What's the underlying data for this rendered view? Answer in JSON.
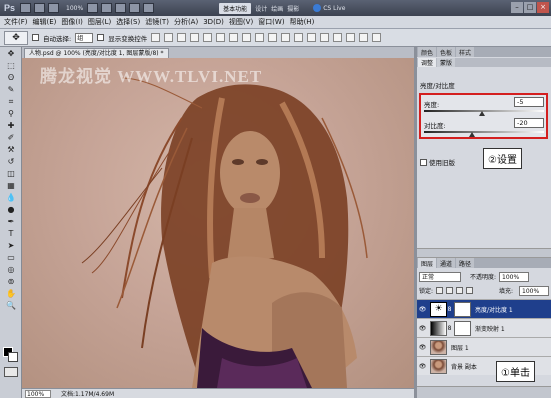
{
  "appbar": {
    "logo": "Ps",
    "zoom": "100%",
    "workspace_active": "基本功能",
    "workspace_options": [
      "设计",
      "绘画",
      "摄影"
    ],
    "cs_live": "CS Live"
  },
  "menu": [
    "文件(F)",
    "编辑(E)",
    "图像(I)",
    "图层(L)",
    "选择(S)",
    "滤镜(T)",
    "分析(A)",
    "3D(D)",
    "视图(V)",
    "窗口(W)",
    "帮助(H)"
  ],
  "options": {
    "auto_select_label": "自动选择:",
    "auto_select_value": "组",
    "show_transform_label": "显示变换控件"
  },
  "document": {
    "tab_title": "人物.psd @ 100% (亮度/对比度 1, 图层蒙版/8) *",
    "watermark": "腾龙视觉 WWW.TLVI.NET",
    "zoom_value": "100%",
    "doc_info": "文档:1.17M/4.69M"
  },
  "adjustments": {
    "tabs": [
      "颜色",
      "色板",
      "样式"
    ],
    "subtabs": [
      "调整",
      "蒙版"
    ],
    "title": "亮度/对比度",
    "brightness_label": "亮度:",
    "brightness_value": "-5",
    "brightness_level": 0.48,
    "contrast_label": "对比度:",
    "contrast_value": "-20",
    "contrast_level": 0.4,
    "use_legacy_label": "使用旧版",
    "note": "②设置"
  },
  "layers": {
    "tabs": [
      "图层",
      "通道",
      "路径"
    ],
    "blend_mode": "正常",
    "opacity_label": "不透明度:",
    "opacity_value": "100%",
    "lock_label": "锁定:",
    "fill_label": "填充:",
    "fill_value": "100%",
    "items": [
      {
        "name": "亮度/对比度 1"
      },
      {
        "name": "渐变映射 1"
      },
      {
        "name": "图层 1"
      },
      {
        "name": "背景 副本"
      }
    ],
    "note": "①单击"
  }
}
